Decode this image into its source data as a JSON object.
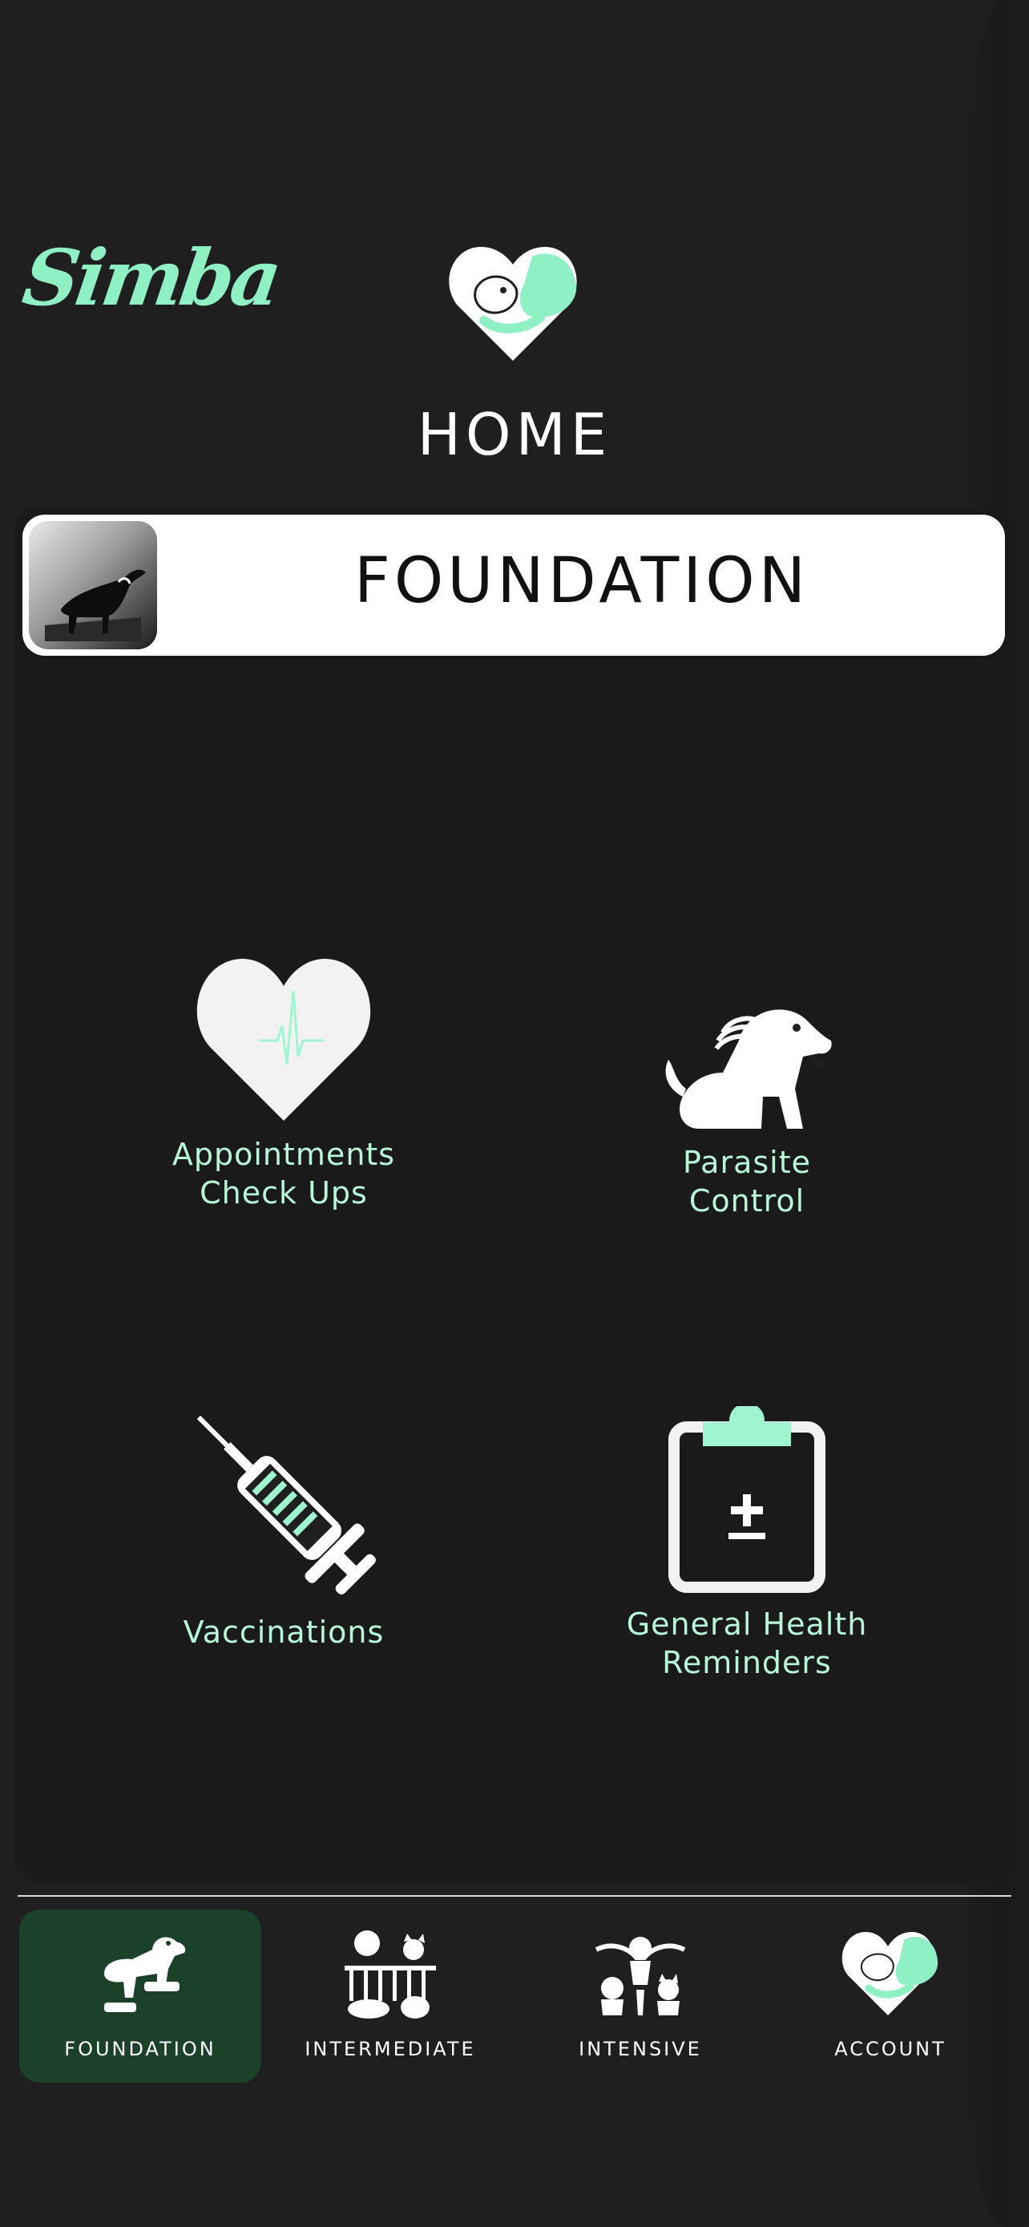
{
  "app": {
    "brand": "Simba"
  },
  "header": {
    "title": "HOME"
  },
  "card": {
    "title": "FOUNDATION"
  },
  "tiles": [
    {
      "label": "Appointments\nCheck Ups",
      "icon": "heart-pulse-icon"
    },
    {
      "label": "Parasite\nControl",
      "icon": "dog-parasite-icon"
    },
    {
      "label": "Vaccinations",
      "icon": "syringe-icon"
    },
    {
      "label": "General Health\nReminders",
      "icon": "clipboard-plus-minus-icon"
    }
  ],
  "nav": [
    {
      "label": "FOUNDATION",
      "icon": "puppy-steps-icon",
      "active": true
    },
    {
      "label": "INTERMEDIATE",
      "icon": "pets-pen-icon",
      "active": false
    },
    {
      "label": "INTENSIVE",
      "icon": "pets-group-icon",
      "active": false
    },
    {
      "label": "ACCOUNT",
      "icon": "heart-dog-cat-icon",
      "active": false
    }
  ],
  "colors": {
    "accent": "#8ff0c3",
    "background": "#1f1f1f",
    "active_tab": "#1b4129"
  }
}
